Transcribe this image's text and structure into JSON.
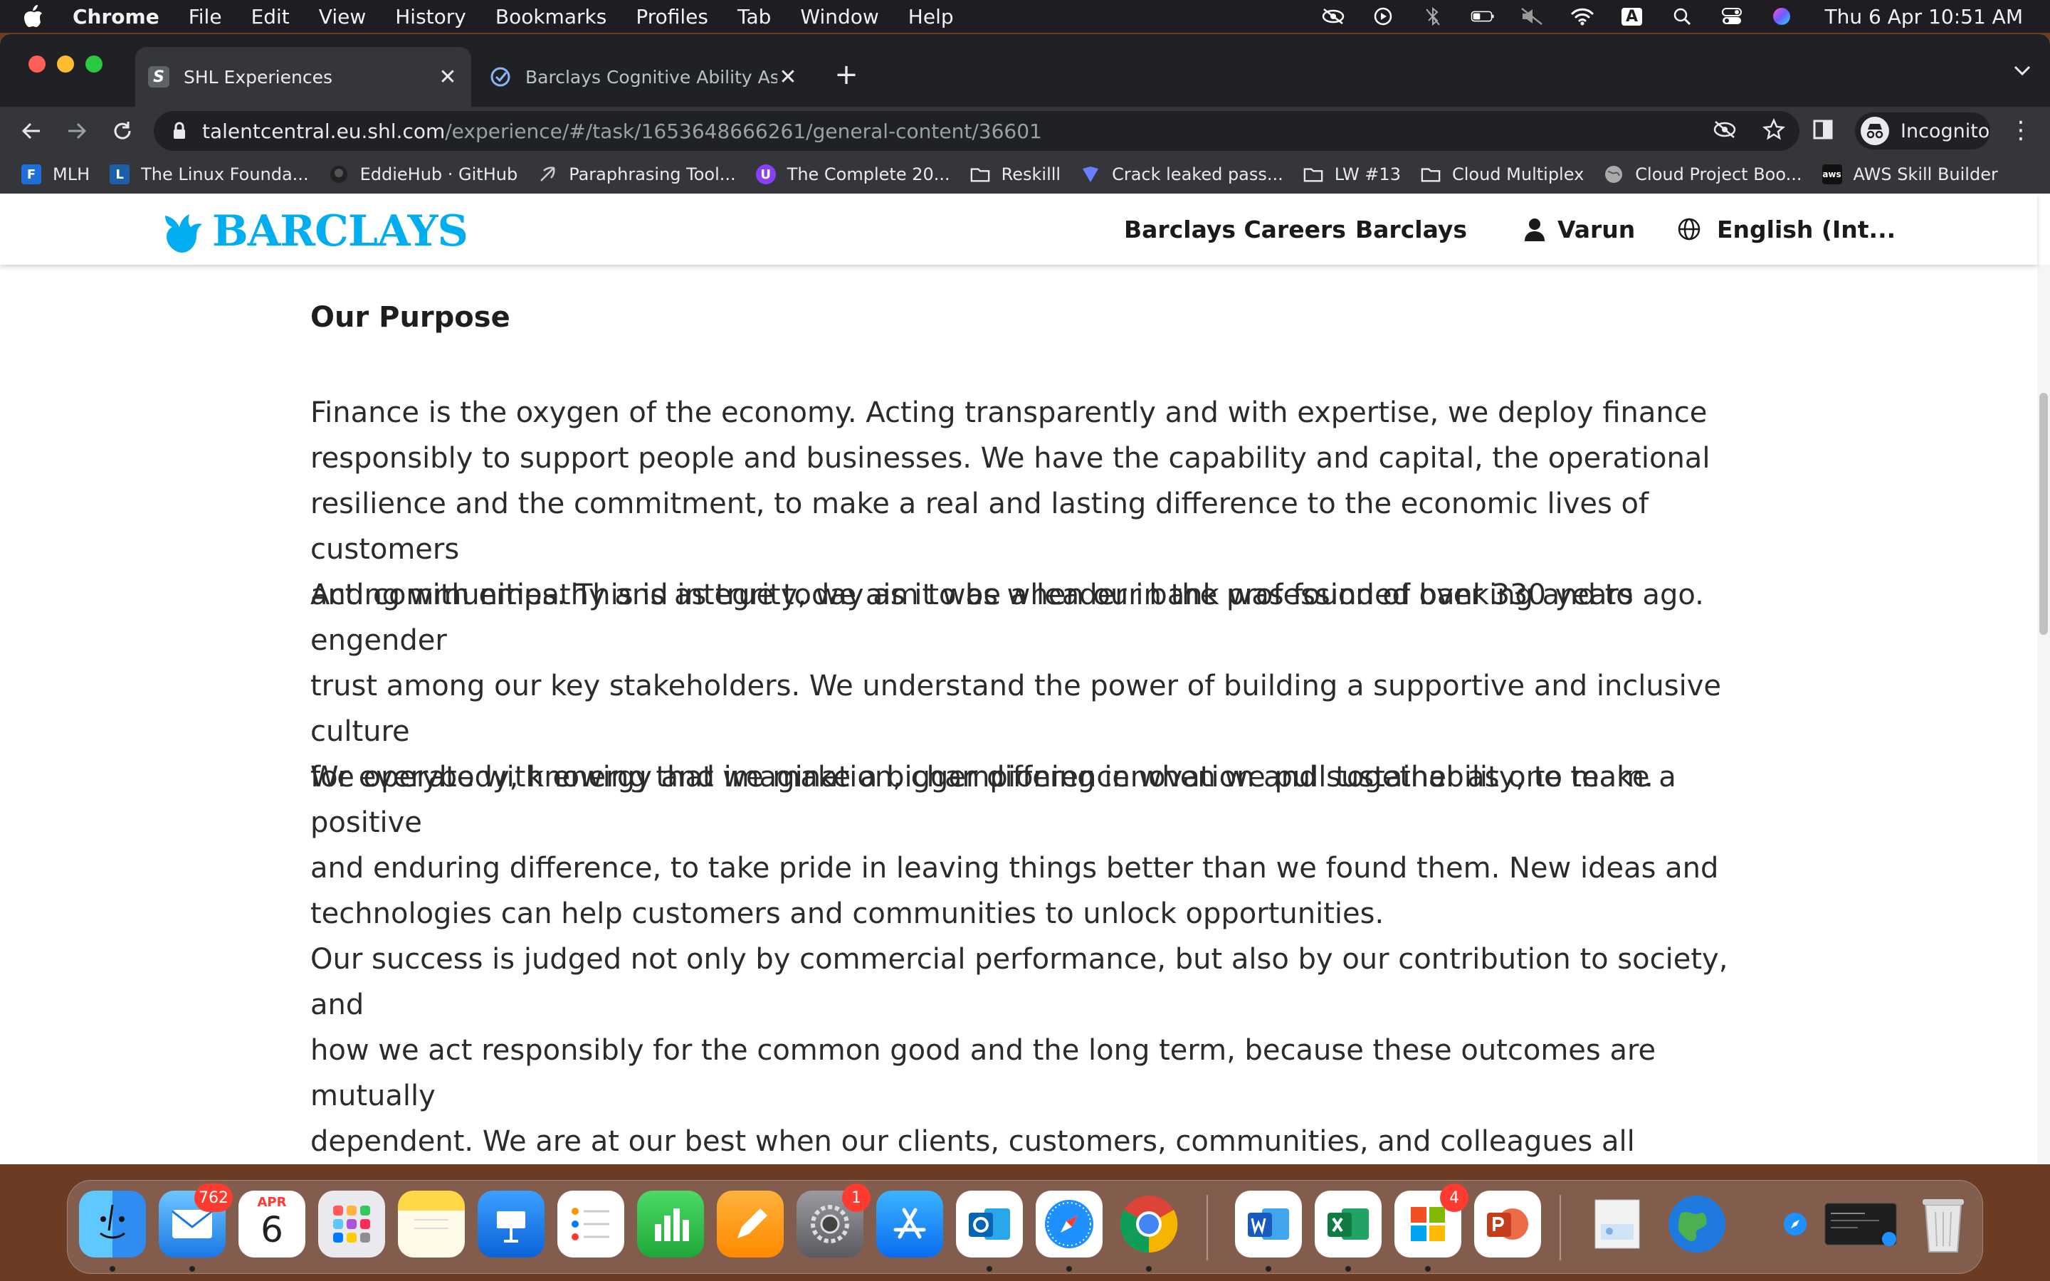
{
  "menubar": {
    "app": "Chrome",
    "menus": [
      "File",
      "Edit",
      "View",
      "History",
      "Bookmarks",
      "Profiles",
      "Tab",
      "Window",
      "Help"
    ],
    "clock": "Thu 6 Apr  10:51 AM",
    "input_source": "A"
  },
  "tabs": [
    {
      "title": "SHL Experiences",
      "active": true,
      "icon": "shl-favicon"
    },
    {
      "title": "Barclays Cognitive Ability Asse",
      "active": false,
      "icon": "check-circle-favicon"
    }
  ],
  "omnibox": {
    "domain": "talentcentral.eu.shl.com",
    "path": "/experience/#/task/1653648666261/general-content/36601"
  },
  "profile": {
    "label": "Incognito"
  },
  "bookmarks": [
    {
      "label": "MLH",
      "icon": "F",
      "color": "#1e6fd9"
    },
    {
      "label": "The Linux Founda...",
      "icon": "L",
      "color": "#1c5fa8"
    },
    {
      "label": "EddieHub · GitHub",
      "icon": "gh",
      "color": "#333333"
    },
    {
      "label": "Paraphrasing Tool...",
      "icon": "feather",
      "color": "#888888"
    },
    {
      "label": "The Complete 20...",
      "icon": "U",
      "color": "#8a3ffc"
    },
    {
      "label": "Reskilll",
      "icon": "folder",
      "color": "#e8eaed"
    },
    {
      "label": "Crack leaked pass...",
      "icon": "shield",
      "color": "#6b7cff"
    },
    {
      "label": "LW #13",
      "icon": "folder",
      "color": "#e8eaed"
    },
    {
      "label": "Cloud Multiplex",
      "icon": "folder",
      "color": "#e8eaed"
    },
    {
      "label": "Cloud Project Boo...",
      "icon": "globe",
      "color": "#aaaaaa"
    },
    {
      "label": "AWS Skill Builder",
      "icon": "aws",
      "color": "#111111"
    }
  ],
  "site": {
    "logo_text": "BARCLAYS",
    "brand_color": "#00aeef",
    "nav": {
      "careers": "Barclays Careers",
      "barclays": "Barclays",
      "user": "Varun",
      "language": "English (Int..."
    }
  },
  "article": {
    "heading": "Our Purpose",
    "paragraphs": [
      [
        "Finance is the oxygen of the economy. Acting transparently and with expertise, we deploy finance",
        "responsibly to support people and businesses. We have the capability and capital, the operational",
        "resilience and the commitment, to make a real and lasting difference to the economic lives of customers",
        "and communities. This is as true today as it was when our bank was founded over 330 years ago."
      ],
      [
        "Acting with empathy and integrity, we aim to be a leader in the profession of banking and to engender",
        "trust among our key stakeholders. We understand the power of building a supportive and inclusive culture",
        "for everybody, knowing that we make a bigger difference when we pull together as one team."
      ],
      [
        "We operate with energy and imagination, championing innovation and sustainability, to make a positive",
        "and enduring difference, to take pride in leaving things better than we found them. New ideas and",
        "technologies can help customers and communities to unlock opportunities."
      ],
      [
        "Our success is judged not only by commercial performance, but also by our contribution to society, and",
        "how we act responsibly for the common good and the long term, because these outcomes are mutually",
        "dependent. We are at our best when our clients, customers, communities, and colleagues all progress."
      ]
    ]
  },
  "dock": {
    "mail_badge": "762",
    "calendar_month": "APR",
    "calendar_day": "6",
    "settings_badge": "1",
    "office_badge": "4",
    "apps": [
      "finder-icon",
      "mail-icon",
      "calendar-icon",
      "launchpad-icon",
      "notes-icon",
      "keynote-icon",
      "reminders-icon",
      "numbers-icon",
      "pages-icon",
      "system-settings-icon",
      "app-store-icon",
      "outlook-icon",
      "safari-icon",
      "chrome-icon",
      "word-icon",
      "excel-icon",
      "microsoft-office-icon",
      "powerpoint-icon",
      "preview-icon",
      "globe-icon",
      "safari-window-icon",
      "terminal-window-icon",
      "trash-icon"
    ]
  }
}
